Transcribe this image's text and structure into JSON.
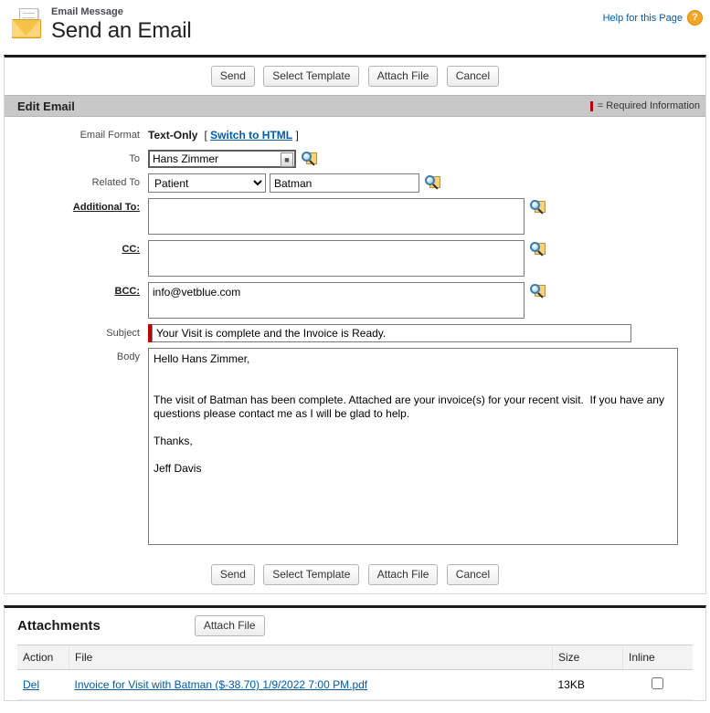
{
  "header": {
    "kicker": "Email Message",
    "title": "Send an Email",
    "icon": "envelope-icon",
    "help_label": "Help for this Page",
    "help_icon": "question-mark-icon"
  },
  "toolbar": {
    "send_label": "Send",
    "select_template_label": "Select Template",
    "attach_file_label": "Attach File",
    "cancel_label": "Cancel"
  },
  "edit_section": {
    "title": "Edit Email",
    "required_legend": "= Required Information"
  },
  "form": {
    "email_format": {
      "label": "Email Format",
      "value": "Text-Only",
      "switch_open": "[",
      "switch_link": "Switch to HTML",
      "switch_close": "]"
    },
    "to": {
      "label": "To",
      "value": "Hans Zimmer",
      "lookup_icon": "lookup-magnifier-icon"
    },
    "related_to": {
      "label": "Related To",
      "selected_option": "Patient",
      "options": [
        "Patient"
      ],
      "value": "Batman",
      "lookup_icon": "lookup-magnifier-icon"
    },
    "additional_to": {
      "label": "Additional To:",
      "value": "",
      "lookup_icon": "lookup-magnifier-icon"
    },
    "cc": {
      "label": "CC:",
      "value": "",
      "lookup_icon": "lookup-magnifier-icon"
    },
    "bcc": {
      "label": "BCC:",
      "value": "info@vetblue.com",
      "lookup_icon": "lookup-magnifier-icon"
    },
    "subject": {
      "label": "Subject",
      "value": "Your Visit is complete and the Invoice is Ready."
    },
    "body": {
      "label": "Body",
      "value": "Hello Hans Zimmer,\n\n\nThe visit of Batman has been complete. Attached are your invoice(s) for your recent visit.  If you have any questions please contact me as I will be glad to help.\n\nThanks,\n\nJeff Davis"
    }
  },
  "attachments": {
    "title": "Attachments",
    "attach_file_label": "Attach File",
    "columns": {
      "action": "Action",
      "file": "File",
      "size": "Size",
      "inline": "Inline"
    },
    "rows": [
      {
        "action": "Del",
        "file": "Invoice for Visit with Batman ($-38.70) 1/9/2022 7:00 PM.pdf",
        "size": "13KB",
        "inline_checked": false
      }
    ]
  },
  "colors": {
    "link": "#015ba7",
    "required": "#c00000",
    "section_bar": "#c8c8c8",
    "accent_envelope": "#f6c347"
  }
}
